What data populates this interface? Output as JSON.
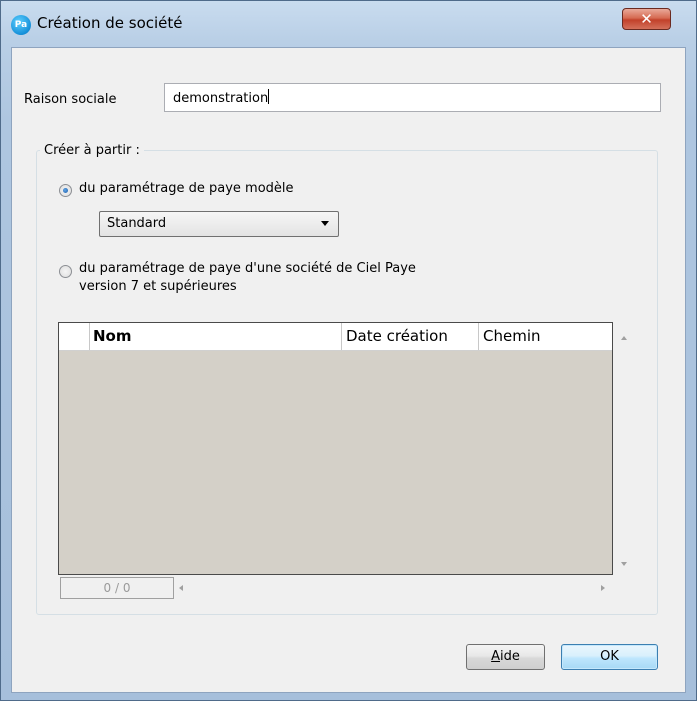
{
  "window": {
    "icon_text": "Pa",
    "title": "Création de société",
    "close_glyph": "✕"
  },
  "form": {
    "raison_label": "Raison sociale",
    "raison_value": "demonstration",
    "group_legend": "Créer à partir :",
    "option_model": {
      "label": "du paramétrage de paye modèle",
      "checked": true,
      "combo_value": "Standard"
    },
    "option_company": {
      "label_line1": "du paramétrage de paye d'une société de Ciel Paye",
      "label_line2": "version 7 et supérieures",
      "checked": false
    }
  },
  "grid": {
    "columns": [
      "Nom",
      "Date création",
      "Chemin"
    ],
    "rows": [],
    "counter": "0 / 0"
  },
  "buttons": {
    "aide_mnemonic": "A",
    "aide_rest": "ide",
    "ok": "OK"
  },
  "colors": {
    "grid_background": "#d4d0c8",
    "dialog_background": "#f0f0f0",
    "close_button": "#c2412a"
  }
}
